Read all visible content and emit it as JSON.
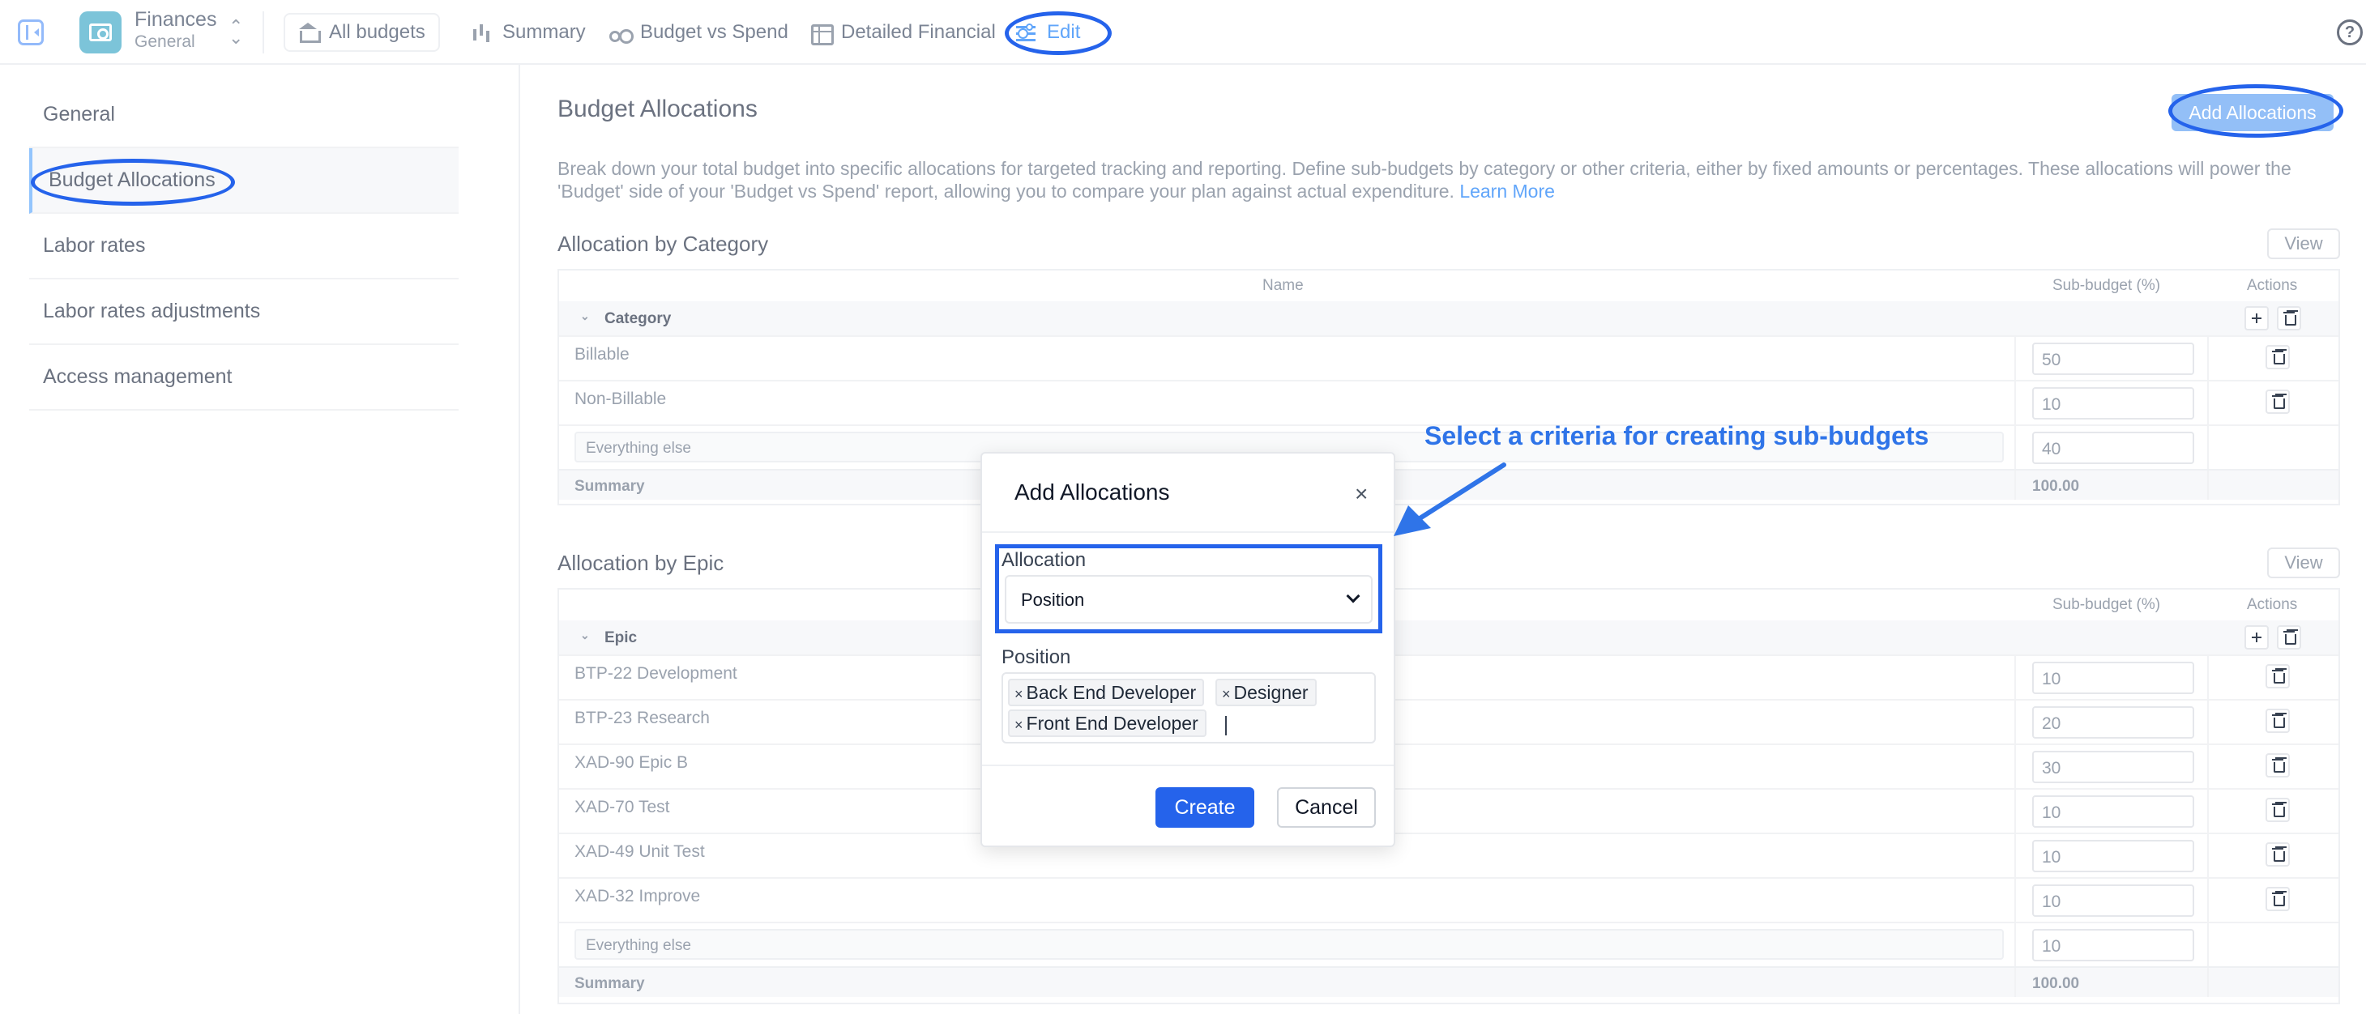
{
  "topbar": {
    "app_title": "Finances",
    "app_subtitle": "General",
    "tabs": [
      {
        "label": "All budgets",
        "icon": "bank-icon"
      },
      {
        "label": "Summary",
        "icon": "chart-icon"
      },
      {
        "label": "Budget vs Spend",
        "icon": "scale-icon"
      },
      {
        "label": "Detailed Financial",
        "icon": "table-icon"
      },
      {
        "label": "Edit",
        "icon": "sliders-icon",
        "active": true
      }
    ],
    "help_glyph": "?"
  },
  "leftnav": {
    "items": [
      {
        "label": "General"
      },
      {
        "label": "Budget Allocations",
        "active": true
      },
      {
        "label": "Labor rates"
      },
      {
        "label": "Labor rates adjustments"
      },
      {
        "label": "Access management"
      }
    ]
  },
  "main": {
    "title": "Budget Allocations",
    "add_button": "Add Allocations",
    "description": "Break down your total budget into specific allocations for targeted tracking and reporting. Define sub-budgets by category or other criteria, either by fixed amounts or percentages. These allocations will power the 'Budget' side of your 'Budget vs Spend' report, allowing you to compare your plan against actual expenditure.",
    "learn_more": "Learn More",
    "category_section": {
      "title": "Allocation by Category",
      "view_button": "View",
      "columns": {
        "name": "Name",
        "sub_budget": "Sub-budget (%)",
        "actions": "Actions"
      },
      "group": "Category",
      "rows": [
        {
          "name": "Billable",
          "value": "50"
        },
        {
          "name": "Non-Billable",
          "value": "10"
        }
      ],
      "else_row": {
        "name": "Everything else",
        "value": "40"
      },
      "summary": {
        "label": "Summary",
        "value": "100.00"
      }
    },
    "epic_section": {
      "title": "Allocation by Epic",
      "view_button": "View",
      "columns": {
        "sub_budget": "Sub-budget (%)",
        "actions": "Actions"
      },
      "group": "Epic",
      "rows": [
        {
          "name": "BTP-22 Development",
          "value": "10"
        },
        {
          "name": "BTP-23 Research",
          "value": "20"
        },
        {
          "name": "XAD-90 Epic B",
          "value": "30"
        },
        {
          "name": "XAD-70 Test",
          "value": "10"
        },
        {
          "name": "XAD-49 Unit Test",
          "value": "10"
        },
        {
          "name": "XAD-32 Improve",
          "value": "10"
        }
      ],
      "else_row": {
        "name": "Everything else",
        "value": "10"
      },
      "summary": {
        "label": "Summary",
        "value": "100.00"
      }
    }
  },
  "modal": {
    "title": "Add Allocations",
    "close_glyph": "×",
    "allocation_label": "Allocation",
    "allocation_value": "Position",
    "position_label": "Position",
    "chips": [
      "Back End Developer",
      "Designer",
      "Front End Developer"
    ],
    "chip_remove_glyph": "×",
    "create_button": "Create",
    "cancel_button": "Cancel"
  },
  "annotation": {
    "text": "Select a criteria for creating sub-budgets",
    "color": "#2f74e8"
  },
  "colors": {
    "accent": "#2563eb",
    "muted_accent": "#93bff7",
    "logo": "#7cc4d9"
  }
}
